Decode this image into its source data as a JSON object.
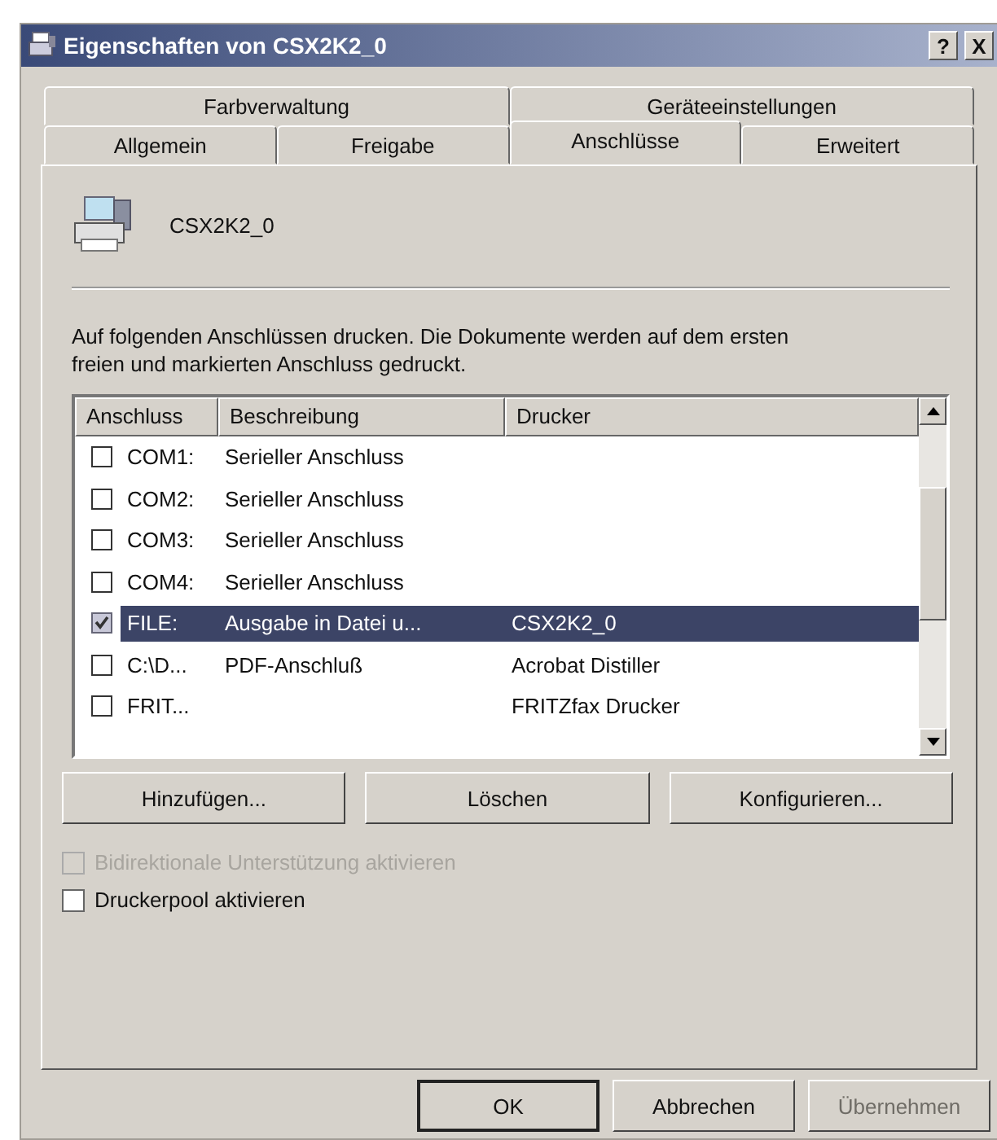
{
  "window": {
    "title": "Eigenschaften von CSX2K2_0",
    "help_button": "?",
    "close_button": "X"
  },
  "tab_rows": [
    [
      {
        "label": "Farbverwaltung",
        "selected": false
      },
      {
        "label": "Geräteeinstellungen",
        "selected": false
      }
    ],
    [
      {
        "label": "Allgemein",
        "selected": false
      },
      {
        "label": "Freigabe",
        "selected": false
      },
      {
        "label": "Anschlüsse",
        "selected": true
      },
      {
        "label": "Erweitert",
        "selected": false
      }
    ]
  ],
  "printer_name": "CSX2K2_0",
  "description": "Auf folgenden Anschlüssen drucken. Die Dokumente werden auf dem ersten freien und markierten Anschluss gedruckt.",
  "ports": {
    "columns": [
      "Anschluss",
      "Beschreibung",
      "Drucker"
    ],
    "rows": [
      {
        "port": "COM1:",
        "description": "Serieller Anschluss",
        "printer": "",
        "checked": false,
        "selected": false
      },
      {
        "port": "COM2:",
        "description": "Serieller Anschluss",
        "printer": "",
        "checked": false,
        "selected": false
      },
      {
        "port": "COM3:",
        "description": "Serieller Anschluss",
        "printer": "",
        "checked": false,
        "selected": false
      },
      {
        "port": "COM4:",
        "description": "Serieller Anschluss",
        "printer": "",
        "checked": false,
        "selected": false
      },
      {
        "port": "FILE:",
        "description": "Ausgabe in Datei u...",
        "printer": "CSX2K2_0",
        "checked": true,
        "selected": true
      },
      {
        "port": "C:\\D...",
        "description": "PDF-Anschluß",
        "printer": "Acrobat Distiller",
        "checked": false,
        "selected": false
      },
      {
        "port": "FRIT...",
        "description": "",
        "printer": "FRITZfax Drucker",
        "checked": false,
        "selected": false
      }
    ]
  },
  "port_buttons": [
    "Hinzufügen...",
    "Löschen",
    "Konfigurieren..."
  ],
  "options": [
    {
      "label": "Bidirektionale Unterstützung aktivieren",
      "checked": false,
      "disabled": true
    },
    {
      "label": "Druckerpool aktivieren",
      "checked": false,
      "disabled": false
    }
  ],
  "dialog_buttons": [
    {
      "label": "OK",
      "disabled": false,
      "default": true
    },
    {
      "label": "Abbrechen",
      "disabled": false,
      "default": false
    },
    {
      "label": "Übernehmen",
      "disabled": true,
      "default": false
    }
  ]
}
